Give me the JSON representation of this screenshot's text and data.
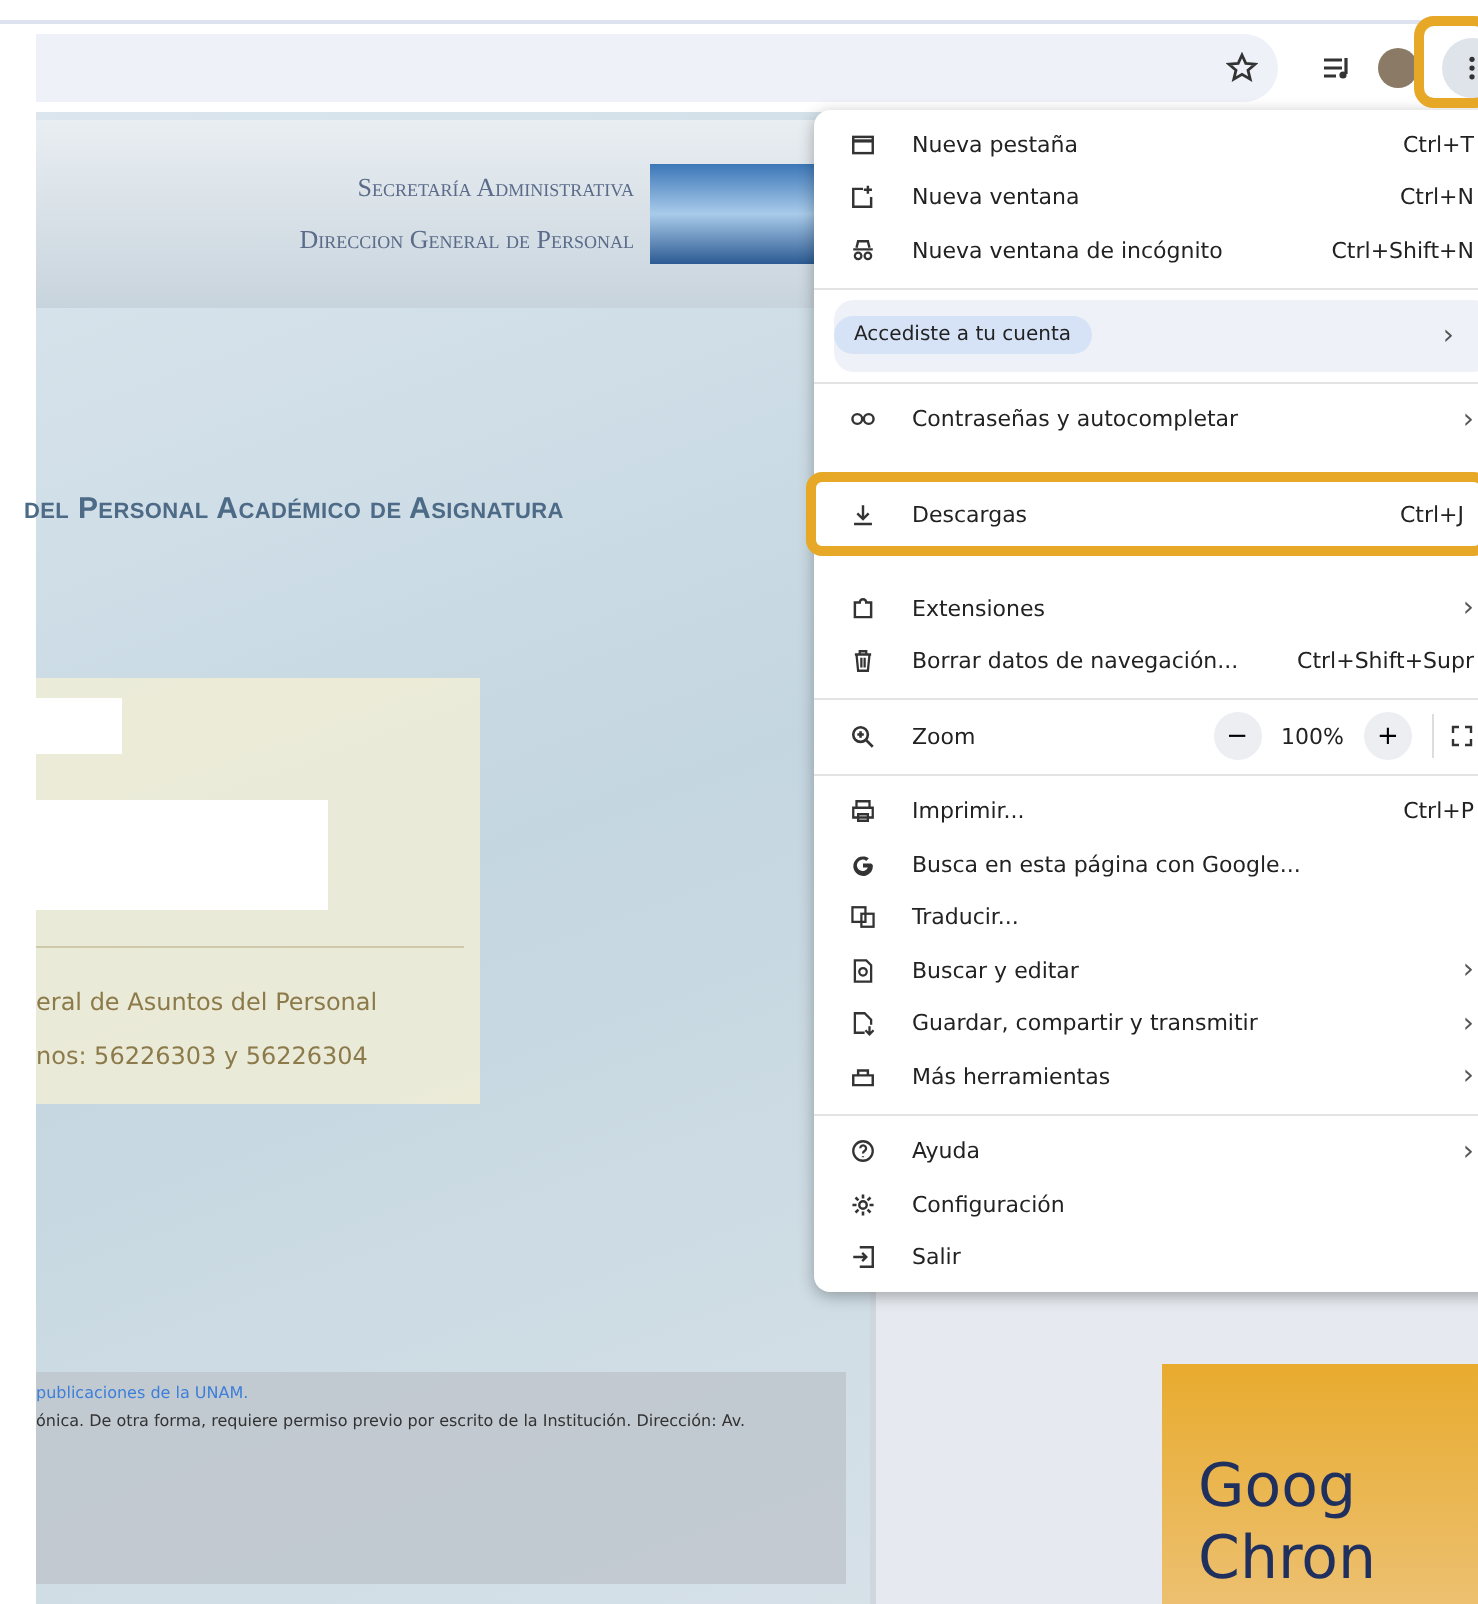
{
  "page": {
    "header_lines": [
      "Secretaría Administrativa",
      "Direccion General de Personal"
    ],
    "title": "del Personal Académico de Asignatura",
    "panel_lines": [
      "eral de Asuntos del Personal",
      "nos: 56226303 y 56226304"
    ],
    "footer_link": "publicaciones de la UNAM.",
    "footer_text": "ónica. De otra forma, requiere permiso previo por escrito de la Institución. Dirección: Av.",
    "promo_lines": [
      "Goog",
      "Chron"
    ]
  },
  "menu": {
    "sections": [
      {
        "items": [
          {
            "kind": "tab",
            "label": "Nueva pestaña",
            "shortcut": "Ctrl+T",
            "selected": false
          },
          {
            "kind": "window",
            "label": "Nueva ventana",
            "shortcut": "Ctrl+N",
            "selected": false
          },
          {
            "kind": "incognito",
            "label": "Nueva ventana de incógnito",
            "shortcut": "Ctrl+Shift+N",
            "selected": false
          }
        ]
      },
      {
        "items": [
          {
            "kind": "account",
            "label": "Accediste a tu cuenta",
            "chevron": "›"
          }
        ]
      },
      {
        "items": [
          {
            "kind": "key",
            "label": "Contraseñas y autocompletar",
            "chevron": "›",
            "selected": false
          },
          {
            "kind": "covered"
          },
          {
            "kind": "download",
            "label": "Descargas",
            "shortcut": "Ctrl+J",
            "selected": true
          },
          {
            "kind": "covered"
          },
          {
            "kind": "extension",
            "label": "Extensiones",
            "chevron": "›",
            "selected": false
          },
          {
            "kind": "trash",
            "label": "Borrar datos de navegación...",
            "shortcut": "Ctrl+Shift+Supr",
            "selected": false
          }
        ]
      },
      {
        "items": [
          {
            "kind": "zoom",
            "label": "Zoom",
            "minus": "−",
            "value": "100%",
            "plus": "+"
          }
        ]
      },
      {
        "items": [
          {
            "kind": "print",
            "label": "Imprimir...",
            "shortcut": "Ctrl+P",
            "selected": false
          },
          {
            "kind": "google",
            "label": "Busca en esta página con Google...",
            "selected": false
          },
          {
            "kind": "translate",
            "label": "Traducir...",
            "selected": false
          },
          {
            "kind": "find",
            "label": "Buscar y editar",
            "chevron": "›",
            "selected": false
          },
          {
            "kind": "save",
            "label": "Guardar, compartir y transmitir",
            "chevron": "›",
            "selected": false
          },
          {
            "kind": "tools",
            "label": "Más herramientas",
            "chevron": "›",
            "selected": false
          }
        ]
      },
      {
        "items": [
          {
            "kind": "help",
            "label": "Ayuda",
            "chevron": "›",
            "selected": false
          },
          {
            "kind": "gear",
            "label": "Configuración",
            "selected": false
          },
          {
            "kind": "exit",
            "label": "Salir",
            "selected": false
          }
        ]
      }
    ]
  }
}
